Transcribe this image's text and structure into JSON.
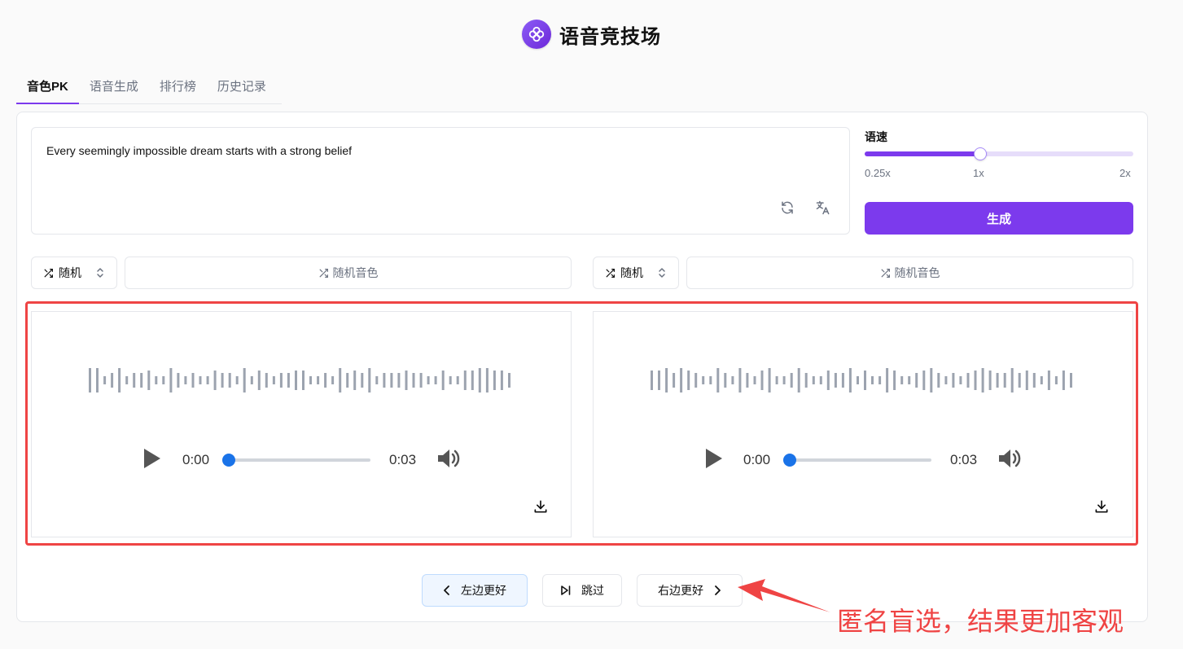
{
  "header": {
    "title": "语音竞技场",
    "logo_icon": "clover-icon",
    "logo_color": "#7c3aed"
  },
  "tabs": [
    {
      "label": "音色PK",
      "active": true
    },
    {
      "label": "语音生成",
      "active": false
    },
    {
      "label": "排行榜",
      "active": false
    },
    {
      "label": "历史记录",
      "active": false
    }
  ],
  "input": {
    "text": "Every seemingly impossible dream starts with a strong belief",
    "icons": [
      "refresh-icon",
      "translate-icon"
    ]
  },
  "speed": {
    "label": "语速",
    "min_label": "0.25x",
    "mid_label": "1x",
    "max_label": "2x",
    "value_fraction": 0.43
  },
  "generate_label": "生成",
  "left": {
    "select_label": "随机",
    "voice_label": "随机音色",
    "time_current": "0:00",
    "time_total": "0:03"
  },
  "right": {
    "select_label": "随机",
    "voice_label": "随机音色",
    "time_current": "0:00",
    "time_total": "0:03"
  },
  "actions": {
    "left_better": "左边更好",
    "skip": "跳过",
    "right_better": "右边更好"
  },
  "annotation": "匿名盲选，结果更加客观",
  "colors": {
    "accent": "#7c3aed",
    "highlight": "#ef4444",
    "player": "#1a73e8"
  }
}
